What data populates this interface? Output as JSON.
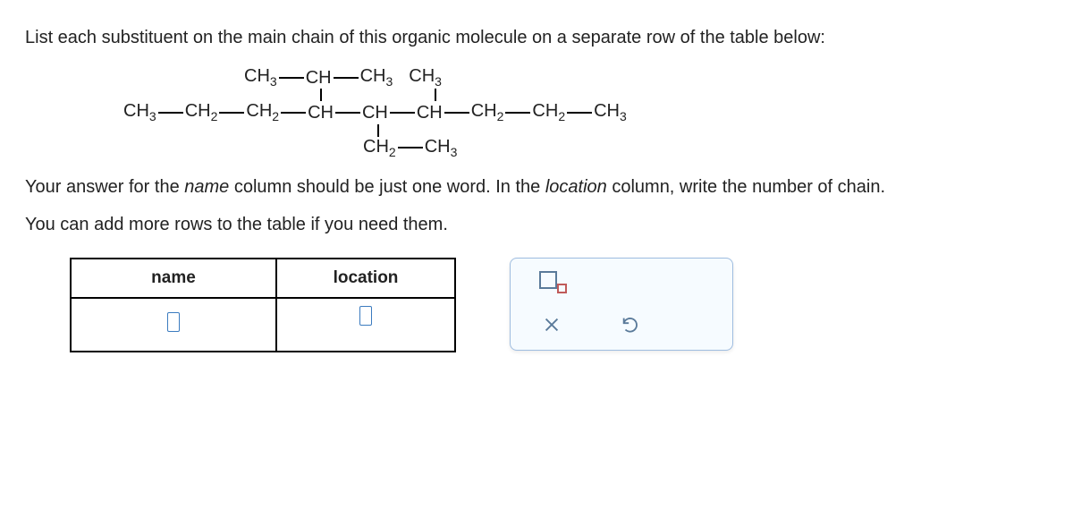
{
  "question": "List each substituent on the main chain of this organic molecule on a separate row of the table below:",
  "molecule": {
    "row1": {
      "groups": [
        "CH3",
        "CH",
        "CH3",
        "CH3"
      ]
    },
    "row2": {
      "groups": [
        "CH3",
        "CH2",
        "CH2",
        "CH",
        "CH",
        "CH",
        "CH2",
        "CH2",
        "CH3"
      ]
    },
    "row3": {
      "groups": [
        "CH2",
        "CH3"
      ]
    }
  },
  "instruction1_prefix": "Your answer for the ",
  "instruction1_name": "name",
  "instruction1_mid": " column should be just one word. In the ",
  "instruction1_location": "location",
  "instruction1_suffix": " column, write the number of chain.",
  "instruction2": "You can add more rows to the table if you need them.",
  "table": {
    "headers": {
      "name": "name",
      "location": "location"
    }
  },
  "tools": {
    "subscript": "subscript-tool",
    "clear": "clear",
    "undo": "undo"
  }
}
